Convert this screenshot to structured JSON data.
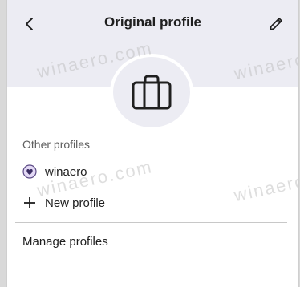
{
  "header": {
    "title": "Original profile",
    "back_icon": "chevron-left-icon",
    "edit_icon": "pencil-icon",
    "background_color": "#ececf3"
  },
  "avatar": {
    "icon": "briefcase-icon"
  },
  "other_profiles": {
    "label": "Other profiles",
    "items": [
      {
        "label": "winaero",
        "icon": "heart-icon",
        "icon_bg": "#e3d9f5"
      }
    ]
  },
  "new_profile": {
    "label": "New profile",
    "icon": "plus-icon"
  },
  "manage_profiles": {
    "label": "Manage profiles"
  },
  "watermarks": [
    "winaero.com",
    "winaero",
    "winaero.com",
    "winaero"
  ]
}
